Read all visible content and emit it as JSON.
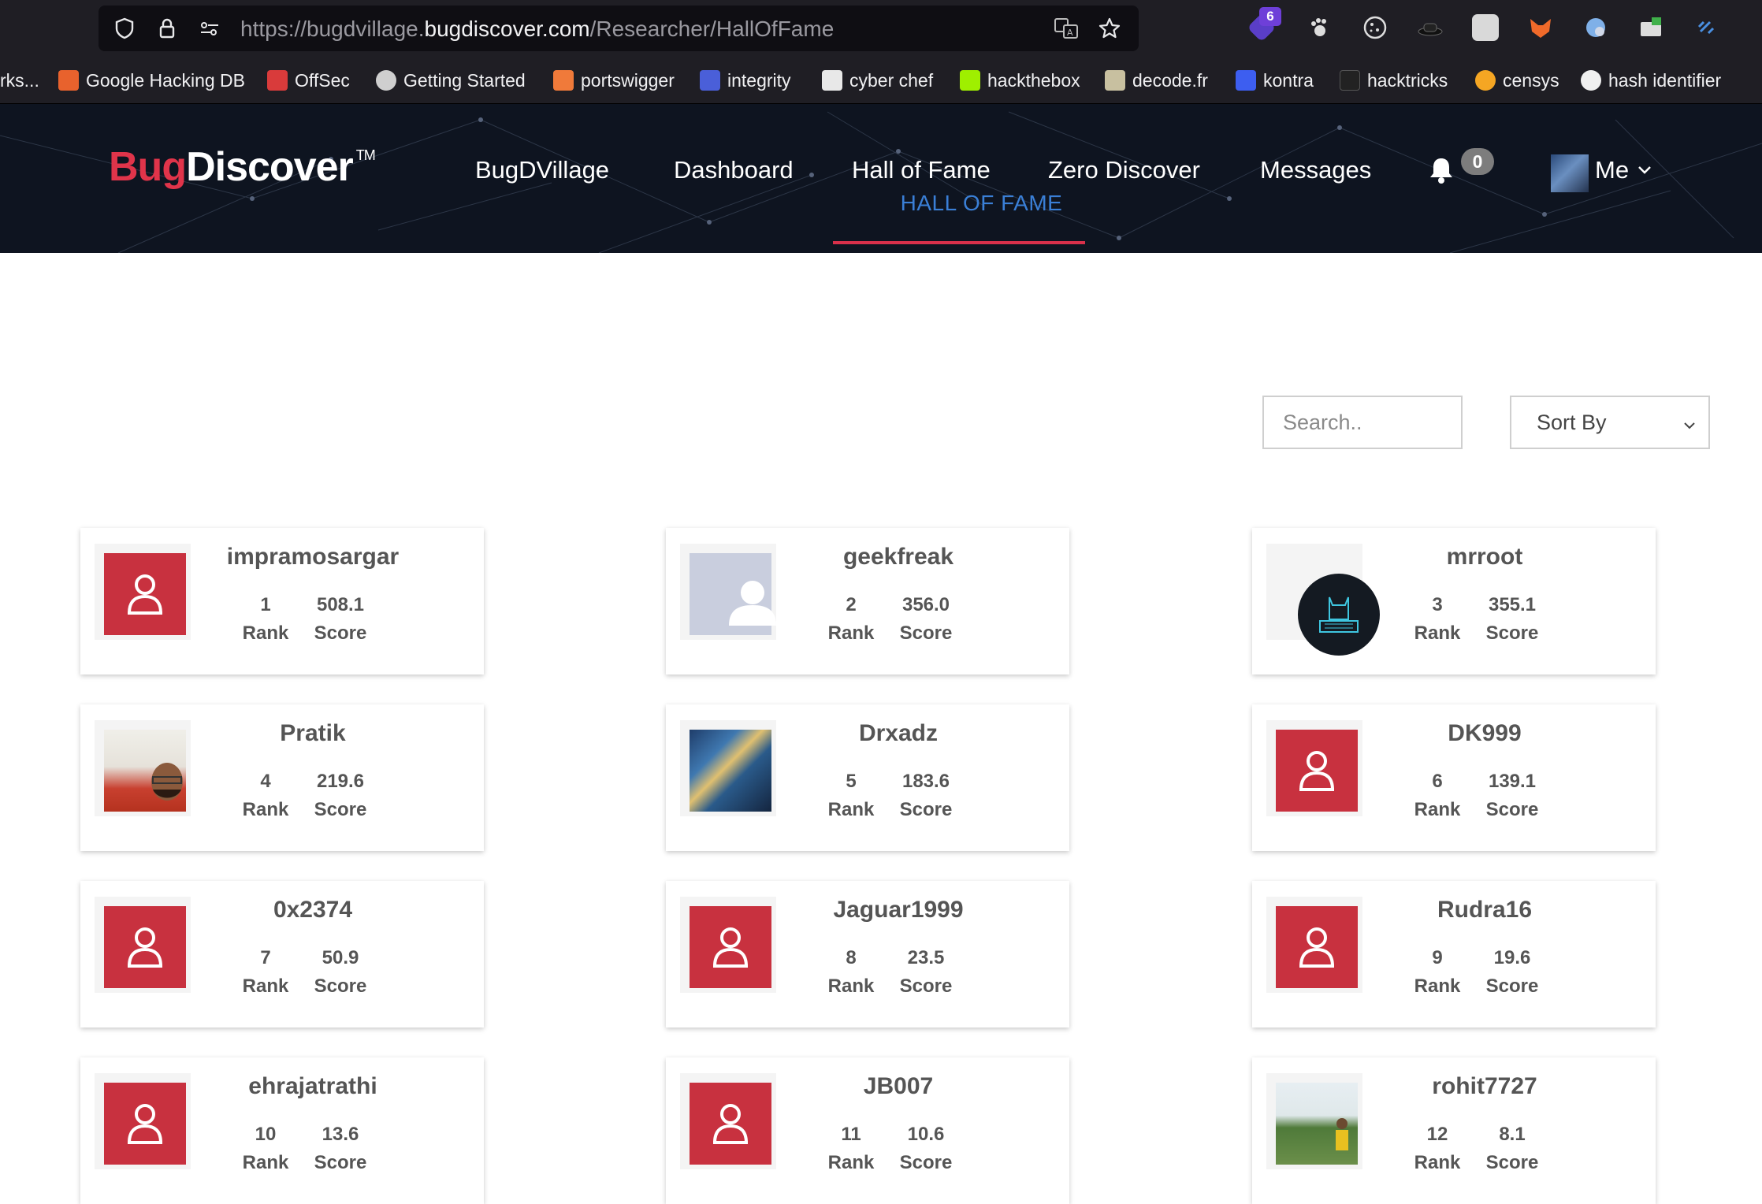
{
  "browser": {
    "url_prefix": "https://bugdvillage.",
    "url_domain": "bugdiscover.com",
    "url_path": "/Researcher/HallOfFame",
    "extension_badge": "6",
    "bookmarks": [
      {
        "label": "rks...",
        "color": "#1f1e24"
      },
      {
        "label": "Google Hacking DB",
        "color": "#e8622d"
      },
      {
        "label": "OffSec",
        "color": "#d93b3b"
      },
      {
        "label": "Getting Started",
        "color": "#cfcfcf"
      },
      {
        "label": "portswigger",
        "color": "#f07a3a"
      },
      {
        "label": "integrity",
        "color": "#4a5fd9"
      },
      {
        "label": "cyber chef",
        "color": "#e8e8e8"
      },
      {
        "label": "hackthebox",
        "color": "#9fef00"
      },
      {
        "label": "decode.fr",
        "color": "#c8c0a0"
      },
      {
        "label": "kontra",
        "color": "#3d5ef0"
      },
      {
        "label": "hacktricks",
        "color": "#222222"
      },
      {
        "label": "censys",
        "color": "#f5a623"
      },
      {
        "label": "hash identifier",
        "color": "#f0f0f0"
      }
    ]
  },
  "header": {
    "logo_bug": "Bug",
    "logo_discover": "Discover",
    "logo_tm": "TM",
    "nav": [
      "BugDVillage",
      "Dashboard",
      "Hall of Fame",
      "Zero Discover",
      "Messages"
    ],
    "notification_count": "0",
    "me_label": "Me"
  },
  "page": {
    "title": "HALL OF FAME",
    "search_placeholder": "Search..",
    "sort_label": "Sort By"
  },
  "colors": {
    "accent_red": "#c8313f",
    "title_blue": "#3a7fd6",
    "header_bg": "#0e1420"
  },
  "rank_label": "Rank",
  "score_label": "Score",
  "researchers": [
    {
      "name": "impramosargar",
      "rank": "1",
      "score": "508.1",
      "avatar": "default"
    },
    {
      "name": "geekfreak",
      "rank": "2",
      "score": "356.0",
      "avatar": "silhouette"
    },
    {
      "name": "mrroot",
      "rank": "3",
      "score": "355.1",
      "avatar": "cat-logo"
    },
    {
      "name": "Pratik",
      "rank": "4",
      "score": "219.6",
      "avatar": "photo-person"
    },
    {
      "name": "Drxadz",
      "rank": "5",
      "score": "183.6",
      "avatar": "art-painting"
    },
    {
      "name": "DK999",
      "rank": "6",
      "score": "139.1",
      "avatar": "default"
    },
    {
      "name": "0x2374",
      "rank": "7",
      "score": "50.9",
      "avatar": "default"
    },
    {
      "name": "Jaguar1999",
      "rank": "8",
      "score": "23.5",
      "avatar": "default"
    },
    {
      "name": "Rudra16",
      "rank": "9",
      "score": "19.6",
      "avatar": "default"
    },
    {
      "name": "ehrajatrathi",
      "rank": "10",
      "score": "13.6",
      "avatar": "default"
    },
    {
      "name": "JB007",
      "rank": "11",
      "score": "10.6",
      "avatar": "default"
    },
    {
      "name": "rohit7727",
      "rank": "12",
      "score": "8.1",
      "avatar": "photo-outdoor"
    }
  ]
}
